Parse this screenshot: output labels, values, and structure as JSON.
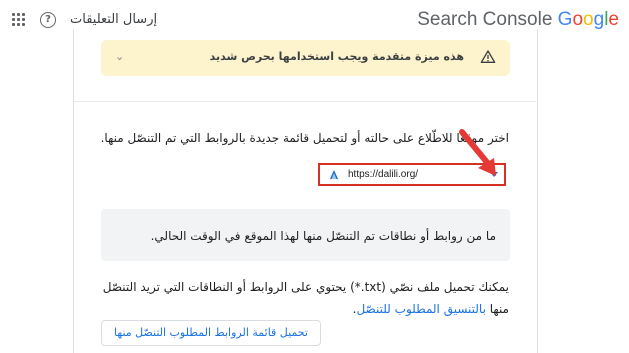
{
  "header": {
    "brand_plain": "Search Console ",
    "brand_google": [
      "G",
      "o",
      "o",
      "g",
      "l",
      "e"
    ],
    "feedback_label": "إرسال التعليقات",
    "help_glyph": "?"
  },
  "warning": {
    "text": "هذه ميزة متقدمة ويجب استخدامها بحرص شديد",
    "icon": "warning-icon",
    "chevron_glyph": "⌄"
  },
  "main": {
    "instruction": "اختر موقعًا للاطّلاع على حالته أو لتحميل قائمة جديدة بالروابط التي تم التنصّل منها.",
    "property_url": "https://dalili.org/",
    "empty_message": "ما من روابط أو نطاقات تم التنصّل منها لهذا الموقع في الوقت الحالي.",
    "upload_desc_1": "يمكنك تحميل ملف نصّي (txt.*) يحتوي على الروابط أو النطاقات التي تريد التنصّل منها ",
    "upload_desc_link": "بالتنسيق المطلوب للتنصّل",
    "upload_desc_2": ".",
    "upload_button": "تحميل قائمة الروابط المطلوب التنصّل منها"
  },
  "colors": {
    "accent": "#1a73e8",
    "warning_bg": "#fdf3cd",
    "highlight": "#d93025"
  }
}
